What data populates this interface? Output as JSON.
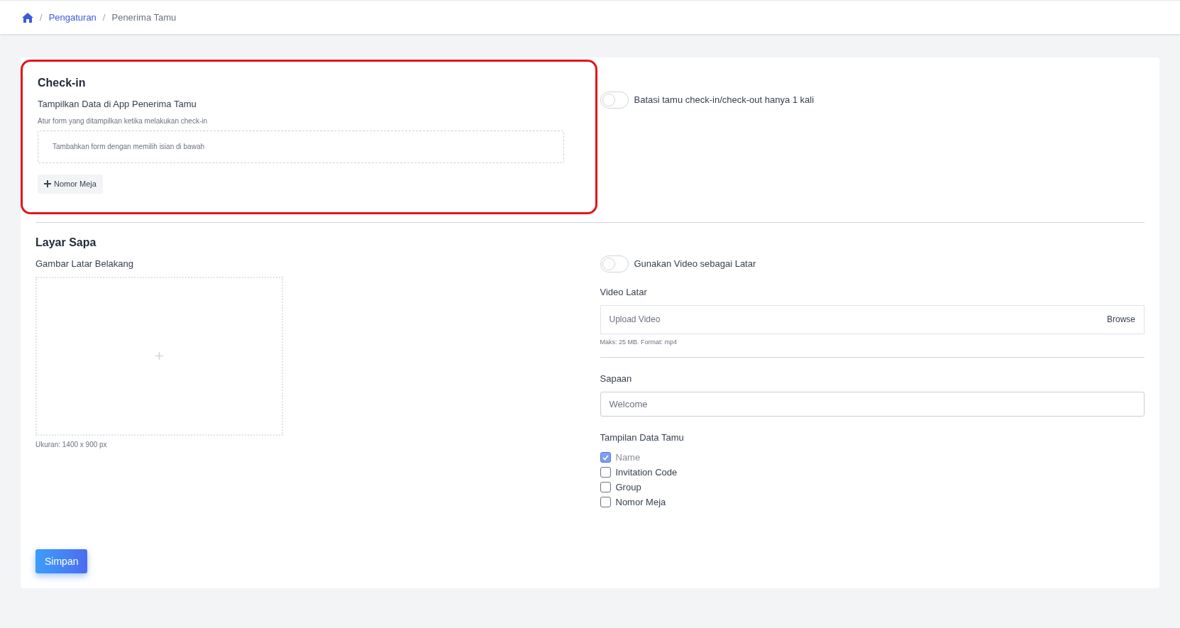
{
  "breadcrumb": {
    "separator": "/",
    "items": [
      {
        "label": "Pengaturan",
        "kind": "link"
      },
      {
        "label": "Penerima Tamu",
        "kind": "current"
      }
    ]
  },
  "checkin": {
    "title": "Check-in",
    "highlighted": true,
    "subtitle": "Tampilkan Data di App Penerima Tamu",
    "hint": "Atur form yang ditampilkan ketika melakukan check-in",
    "dropzone": "Tambahkan form dengan memilih isian di bawah",
    "add_buttons": [
      "Nomor Meja"
    ],
    "toggle": {
      "label": "Batasi tamu check-in/check-out hanya 1 kali",
      "on": false
    }
  },
  "layar_sapa": {
    "title": "Layar Sapa",
    "image_label": "Gambar Latar Belakang",
    "image_hint": "Ukuran: 1400 x 900 px",
    "video_toggle": {
      "label": "Gunakan Video sebagai Latar",
      "on": false
    },
    "video_label": "Video Latar",
    "video_placeholder": "Upload Video",
    "browse": "Browse",
    "video_hint": "Maks: 25 MB. Format: mp4",
    "greeting_label": "Sapaan",
    "greeting_placeholder": "Welcome",
    "guest_data_label": "Tampilan Data Tamu",
    "guest_data_options": [
      {
        "label": "Name",
        "checked": true,
        "disabled": true
      },
      {
        "label": "Invitation Code",
        "checked": false,
        "disabled": false
      },
      {
        "label": "Group",
        "checked": false,
        "disabled": false
      },
      {
        "label": "Nomor Meja",
        "checked": false,
        "disabled": false
      }
    ]
  },
  "save_button": "Simpan"
}
